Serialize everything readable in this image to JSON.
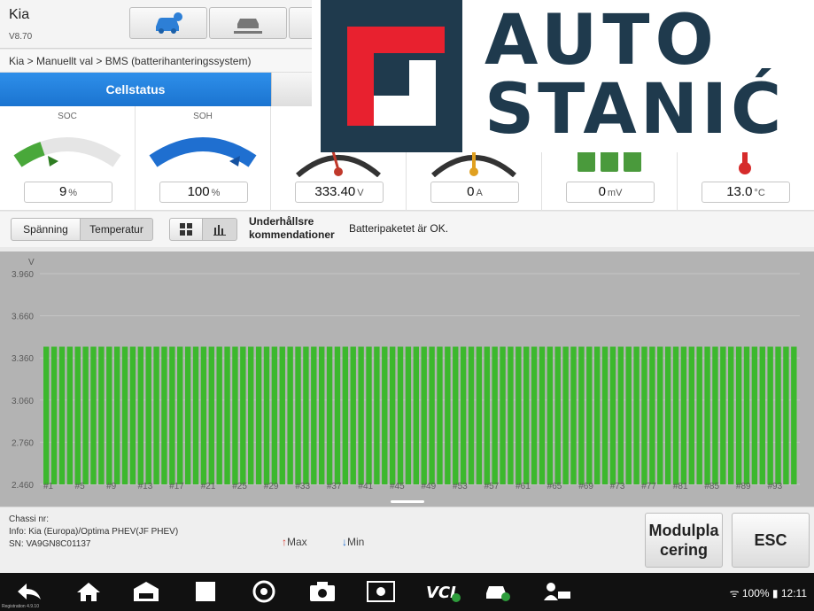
{
  "header": {
    "title": "Kia",
    "version": "V8.70"
  },
  "breadcrumb": "Kia > Manuellt val > BMS (batterihanteringssystem)",
  "tabs": [
    {
      "label": "Cellstatus"
    },
    {
      "label": ""
    }
  ],
  "gauges": [
    {
      "label": "SOC",
      "value": "9",
      "unit": "%",
      "level": 0.09
    },
    {
      "label": "SOH",
      "value": "100",
      "unit": "%",
      "level": 1.0
    },
    {
      "label": "",
      "value": "333.40",
      "unit": "V"
    },
    {
      "label": "",
      "value": "0",
      "unit": "A"
    },
    {
      "label": "",
      "value": "0",
      "unit": "mV"
    },
    {
      "label": "",
      "value": "13.0",
      "unit": "°C"
    }
  ],
  "controls": {
    "voltage_label": "Spänning",
    "temperature_label": "Temperatur",
    "maintenance_label": "Underhållsre kommendationer",
    "maintenance_text": "Batteripaketet är OK."
  },
  "chart_data": {
    "type": "bar",
    "ylabel": "V",
    "ylim": [
      2.46,
      3.96
    ],
    "yticks": [
      "3.960",
      "3.660",
      "3.360",
      "3.060",
      "2.760",
      "2.460"
    ],
    "xtick_labels": [
      "#1",
      "#5",
      "#9",
      "#13",
      "#17",
      "#21",
      "#25",
      "#29",
      "#33",
      "#37",
      "#41",
      "#45",
      "#49",
      "#53",
      "#57",
      "#61",
      "#65",
      "#69",
      "#73",
      "#77",
      "#81",
      "#85",
      "#89",
      "#93"
    ],
    "bar_count": 96,
    "bar_value": 3.44,
    "bar_color": "#3cb82d"
  },
  "footer": {
    "chassis": "Chassi nr:",
    "info": "Info: Kia (Europa)/Optima PHEV(JF PHEV)",
    "sn": "SN: VA9GN8C01137",
    "legend_max": "Max",
    "legend_min": "Min",
    "module_button": "Modulpla cering",
    "esc_button": "ESC"
  },
  "status_bar": {
    "battery": "100%",
    "time": "12:11"
  },
  "registration": "Registration 4.9.10",
  "logo": {
    "line1": "AUTO",
    "line2": "STANIĆ"
  },
  "colors": {
    "accent": "#1b74d0",
    "bar": "#3cb82d",
    "logo_navy": "#1f3a4d",
    "logo_red": "#e8212f"
  }
}
